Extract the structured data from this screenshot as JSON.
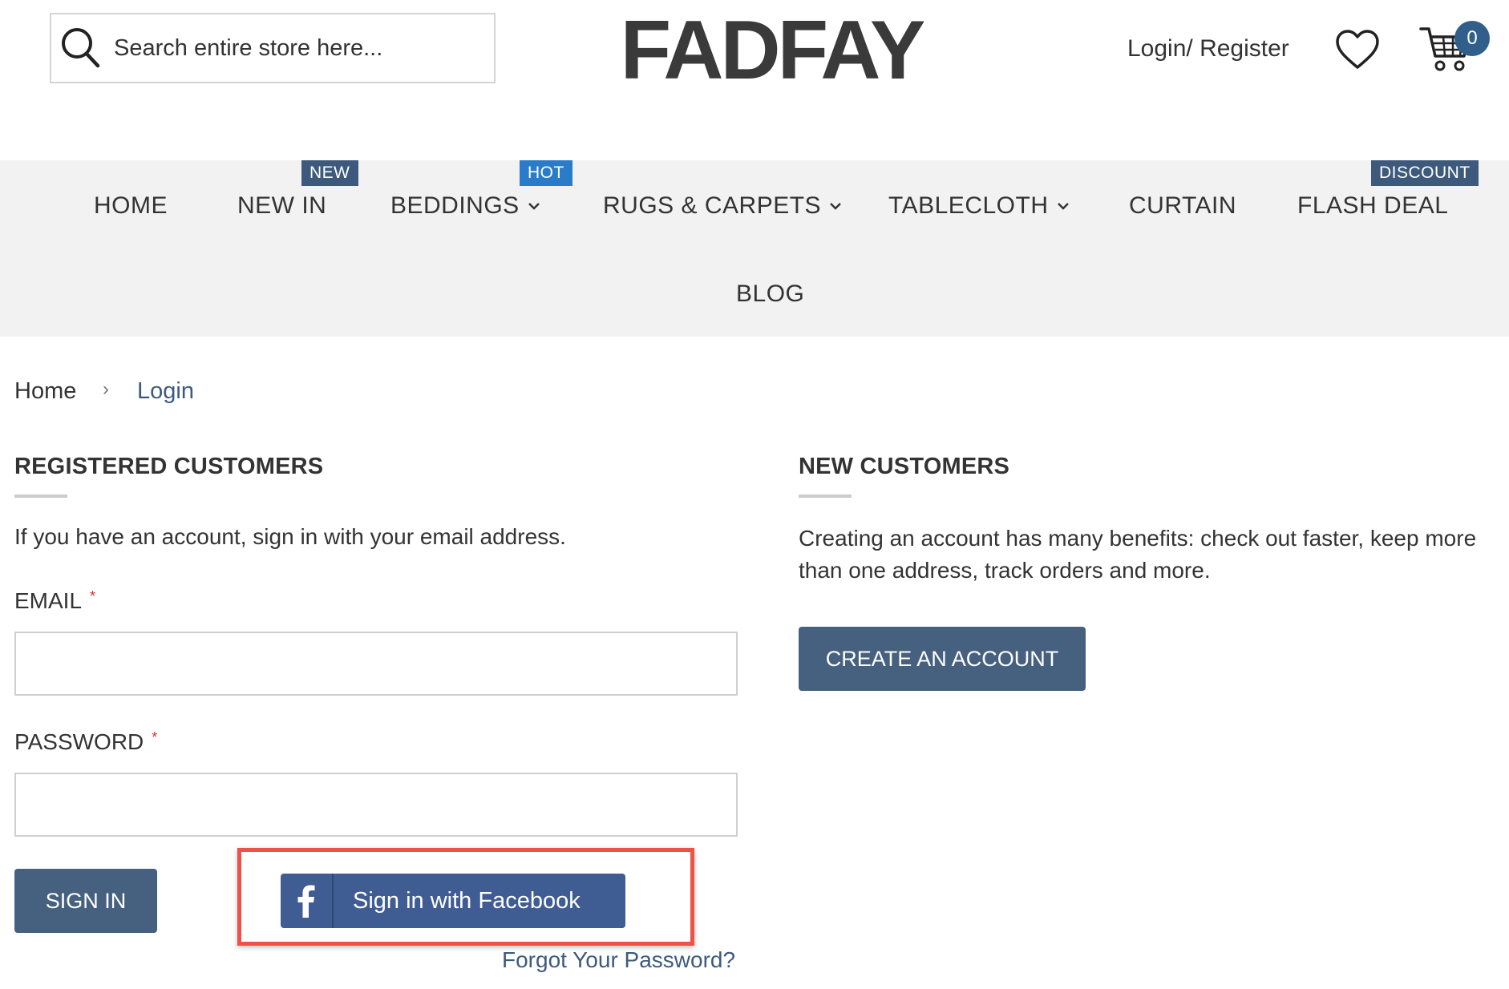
{
  "header": {
    "search_placeholder": "Search entire store here...",
    "logo_text": "FADFAY",
    "login_register": "Login/ Register",
    "cart_count": "0"
  },
  "nav": {
    "items": [
      {
        "label": "HOME"
      },
      {
        "label": "NEW IN",
        "badge": "NEW"
      },
      {
        "label": "BEDDINGS",
        "badge": "HOT",
        "dropdown": true
      },
      {
        "label": "RUGS & CARPETS",
        "dropdown": true
      },
      {
        "label": "TABLECLOTH",
        "dropdown": true
      },
      {
        "label": "CURTAIN"
      },
      {
        "label": "FLASH DEAL",
        "badge": "DISCOUNT"
      },
      {
        "label": "BLOG"
      }
    ]
  },
  "breadcrumb": {
    "home": "Home",
    "separator": "›",
    "current": "Login"
  },
  "registered": {
    "title": "REGISTERED CUSTOMERS",
    "intro": "If you have an account, sign in with your email address.",
    "email_label": "EMAIL",
    "password_label": "PASSWORD",
    "required_mark": "*",
    "sign_in_label": "SIGN IN",
    "facebook_label": "Sign in with Facebook",
    "forgot_label": "Forgot Your Password?"
  },
  "new_customers": {
    "title": "NEW CUSTOMERS",
    "text": "Creating an account has many benefits: check out faster, keep more than one address, track orders and more.",
    "create_label": "CREATE AN ACCOUNT"
  },
  "colors": {
    "primary_button": "#46617f",
    "facebook": "#3f5c93",
    "highlight": "#ee5146",
    "link": "#3d5a7d",
    "badge_hot": "#2a7cc8",
    "badge_navy": "#3d5a7d"
  }
}
